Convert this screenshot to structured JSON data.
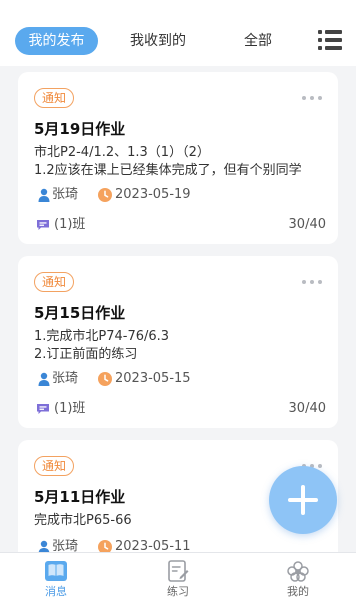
{
  "header": {
    "tabs": [
      {
        "label": "我的发布",
        "active": true
      },
      {
        "label": "我收到的",
        "active": false
      },
      {
        "label": "全部",
        "active": false
      }
    ],
    "menu_icon": "list-menu-icon"
  },
  "cards": [
    {
      "badge": "通知",
      "title": "5月19日作业",
      "lines": [
        "市北P2-4/1.2、1.3（1）（2）",
        "1.2应该在课上已经集体完成了，但有个别同学"
      ],
      "author": "张琦",
      "date": "2023-05-19",
      "class": "(1)班",
      "count": "30/40"
    },
    {
      "badge": "通知",
      "title": "5月15日作业",
      "lines": [
        "1.完成市北P74-76/6.3",
        "2.订正前面的练习"
      ],
      "author": "张琦",
      "date": "2023-05-15",
      "class": "(1)班",
      "count": "30/40"
    },
    {
      "badge": "通知",
      "title": "5月11日作业",
      "lines": [
        "完成市北P65-66"
      ],
      "author": "张琦",
      "date": "2023-05-11",
      "class": "",
      "count": ""
    }
  ],
  "fab": {
    "icon": "plus-icon"
  },
  "bottom_nav": [
    {
      "label": "消息",
      "icon": "message-book-icon",
      "active": true
    },
    {
      "label": "练习",
      "icon": "exercise-edit-icon",
      "active": false
    },
    {
      "label": "我的",
      "icon": "profile-flower-icon",
      "active": false
    }
  ],
  "colors": {
    "accent": "#5aa9ee",
    "badge": "#f08a3c",
    "person_icon": "#3a86d6",
    "clock_icon": "#f5a25d",
    "chat_icon": "#7e6fd8",
    "fab": "#8ec4f6"
  }
}
